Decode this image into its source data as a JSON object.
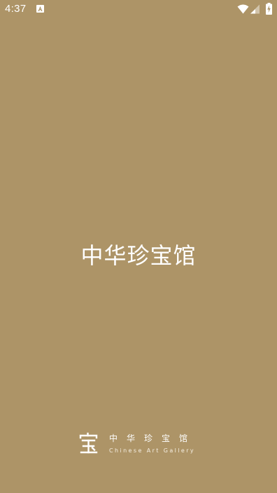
{
  "status_bar": {
    "time": "4:37",
    "notification_icon": "accessibility-app-icon",
    "wifi_icon": "wifi-full-icon",
    "signal_icon": "cell-signal-partial-icon",
    "battery_icon": "battery-charging-icon"
  },
  "splash": {
    "title": "中华珍宝馆",
    "background_color": "#ad9467"
  },
  "footer_logo": {
    "seal_glyph": "宝",
    "name_cn": "中华珍宝馆",
    "name_en": "Chinese Art Gallery"
  }
}
